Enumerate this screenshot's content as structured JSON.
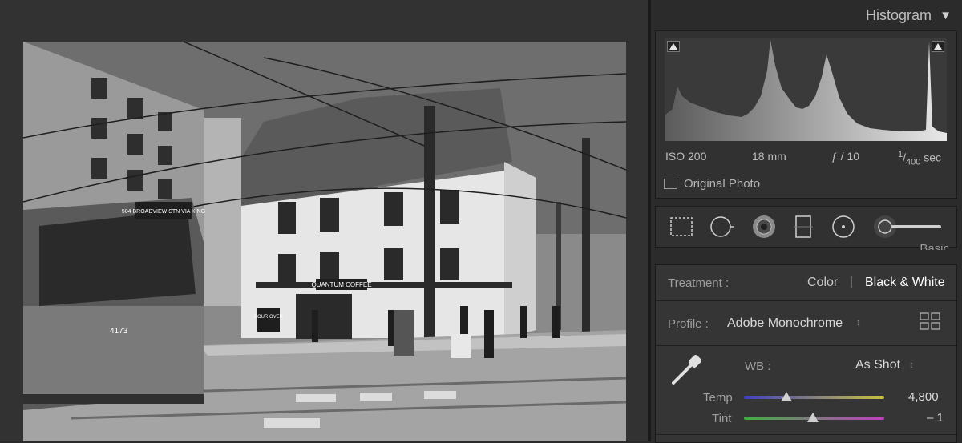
{
  "histogram": {
    "title": "Histogram",
    "collapse_icon": "triangle-down-icon",
    "exif": {
      "iso": "ISO 200",
      "focal": "18 mm",
      "aperture": "ƒ / 10",
      "shutter_num": "1",
      "shutter_den": "400",
      "shutter_unit": "sec"
    },
    "original_photo_label": "Original Photo"
  },
  "tools": [
    "crop-overlay-icon",
    "spot-removal-icon",
    "red-eye-icon",
    "graduated-filter-icon",
    "radial-filter-icon",
    "adjustment-brush-icon"
  ],
  "basic": {
    "peek_title": "Basic",
    "treatment": {
      "label": "Treatment :",
      "color": "Color",
      "divider": "|",
      "bw": "Black & White"
    },
    "profile": {
      "label": "Profile :",
      "value": "Adobe Monochrome",
      "stepper": "↕",
      "browser_icon": "profile-grid-icon"
    },
    "wb": {
      "label": "WB :",
      "value": "As Shot",
      "stepper": "↕"
    },
    "temp": {
      "label": "Temp",
      "value": "4,800",
      "level": 0.3
    },
    "tint": {
      "label": "Tint",
      "value": "– 1",
      "level": 0.49
    }
  },
  "photo": {
    "streetcar_sign": "504 BROADVIEW STN VIA KING",
    "streetcar_number": "4173",
    "shop_sign": "QUANTUM COFFEE",
    "pour_sign": "POUR OVER"
  },
  "colors": {
    "accent_text": "#d8d8d8",
    "panel": "#353535",
    "temp_gradient": [
      "#4040c0",
      "#c8c040"
    ],
    "tint_gradient": [
      "#40b040",
      "#c040c0"
    ]
  }
}
